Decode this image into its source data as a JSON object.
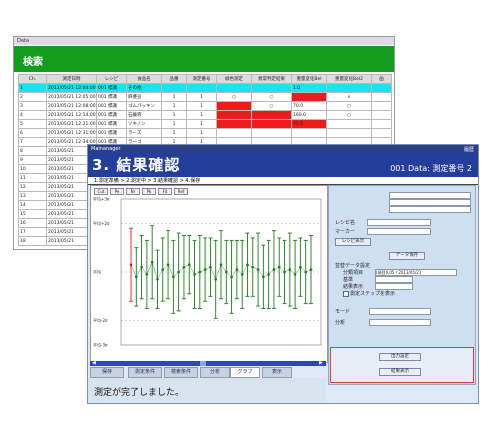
{
  "back_window": {
    "title": "Data",
    "header": "検索",
    "columns": [
      "Ch.",
      "測定日時",
      "レシピ",
      "食品名",
      "品番",
      "測定番号",
      "緑色測定",
      "異常判定結果",
      "重量変化Bel",
      "重量変化Bel2",
      "画"
    ],
    "rows": [
      {
        "no": "1",
        "date": "2013/05/21 12:04:00",
        "recipe": "001 標識",
        "name": "その他",
        "v1": "",
        "v2": "",
        "c1": "",
        "c2": "",
        "val": "1.0",
        "c3": "",
        "highlight": true,
        "red1": false,
        "red2": false,
        "red3": false
      },
      {
        "no": "2",
        "date": "2013/05/21 12:05:00",
        "recipe": "001 標識",
        "name": "麻婆豆",
        "v1": "1",
        "v2": "1",
        "c1": "○",
        "c2": "○",
        "val": "",
        "c3": "×",
        "highlight": false,
        "red1": false,
        "red2": false,
        "red3": true
      },
      {
        "no": "3",
        "date": "2013/05/21 12:08:00",
        "recipe": "001 標識",
        "name": "ゴムパッキン",
        "v1": "1",
        "v2": "1",
        "c1": "",
        "c2": "○",
        "val": "70.0",
        "c3": "○",
        "highlight": false,
        "red1": true,
        "red2": false,
        "red3": false
      },
      {
        "no": "4",
        "date": "2013/05/21 12:14:00",
        "recipe": "001 標識",
        "name": "石鹸液",
        "v1": "1",
        "v2": "1",
        "c1": "",
        "c2": "",
        "val": "160.0",
        "c3": "○",
        "highlight": false,
        "red1": true,
        "red2": true,
        "red3": false
      },
      {
        "no": "5",
        "date": "2013/05/21 12:21:00",
        "recipe": "001 標識",
        "name": "ソキノン",
        "v1": "1",
        "v2": "1",
        "c1": "",
        "c2": "",
        "val": "75.0",
        "c3": "",
        "highlight": false,
        "red1": true,
        "red2": true,
        "red3": true
      },
      {
        "no": "6",
        "date": "2013/05/21 12:31:00",
        "recipe": "001 標識",
        "name": "ラーズ",
        "v1": "1",
        "v2": "1",
        "c1": "",
        "c2": "",
        "val": "",
        "c3": "",
        "highlight": false,
        "red1": false,
        "red2": false,
        "red3": false
      },
      {
        "no": "7",
        "date": "2013/05/21 12:34:00",
        "recipe": "001 標識",
        "name": "ラーゴ",
        "v1": "1",
        "v2": "1",
        "c1": "",
        "c2": "",
        "val": "",
        "c3": "",
        "highlight": false,
        "red1": false,
        "red2": false,
        "red3": false
      },
      {
        "no": "8",
        "date": "2013/05/21",
        "recipe": "",
        "name": "",
        "v1": "",
        "v2": "",
        "c1": "",
        "c2": "",
        "val": "",
        "c3": "",
        "highlight": false,
        "red1": false,
        "red2": false,
        "red3": false
      },
      {
        "no": "9",
        "date": "2013/05/21",
        "recipe": "",
        "name": "",
        "v1": "",
        "v2": "",
        "c1": "",
        "c2": "",
        "val": "",
        "c3": "",
        "highlight": false,
        "red1": false,
        "red2": false,
        "red3": false
      },
      {
        "no": "10",
        "date": "2013/05/21",
        "recipe": "",
        "name": "",
        "v1": "",
        "v2": "",
        "c1": "",
        "c2": "",
        "val": "",
        "c3": "",
        "highlight": false,
        "red1": false,
        "red2": false,
        "red3": false
      },
      {
        "no": "11",
        "date": "2013/05/21",
        "recipe": "",
        "name": "",
        "v1": "",
        "v2": "",
        "c1": "",
        "c2": "",
        "val": "",
        "c3": "",
        "highlight": false,
        "red1": false,
        "red2": false,
        "red3": false
      },
      {
        "no": "12",
        "date": "2013/05/21",
        "recipe": "",
        "name": "",
        "v1": "",
        "v2": "",
        "c1": "",
        "c2": "",
        "val": "",
        "c3": "",
        "highlight": false,
        "red1": false,
        "red2": false,
        "red3": false
      },
      {
        "no": "13",
        "date": "2013/05/21",
        "recipe": "",
        "name": "",
        "v1": "",
        "v2": "",
        "c1": "",
        "c2": "",
        "val": "",
        "c3": "",
        "highlight": false,
        "red1": false,
        "red2": false,
        "red3": false
      },
      {
        "no": "14",
        "date": "2013/05/21",
        "recipe": "",
        "name": "",
        "v1": "",
        "v2": "",
        "c1": "",
        "c2": "",
        "val": "",
        "c3": "",
        "highlight": false,
        "red1": false,
        "red2": false,
        "red3": false
      },
      {
        "no": "15",
        "date": "2013/05/21",
        "recipe": "",
        "name": "",
        "v1": "",
        "v2": "",
        "c1": "",
        "c2": "",
        "val": "",
        "c3": "",
        "highlight": false,
        "red1": false,
        "red2": false,
        "red3": false
      },
      {
        "no": "16",
        "date": "2013/05/21",
        "recipe": "",
        "name": "",
        "v1": "",
        "v2": "",
        "c1": "",
        "c2": "",
        "val": "",
        "c3": "",
        "highlight": false,
        "red1": false,
        "red2": false,
        "red3": false
      },
      {
        "no": "17",
        "date": "2013/05/21",
        "recipe": "",
        "name": "",
        "v1": "",
        "v2": "",
        "c1": "",
        "c2": "",
        "val": "",
        "c3": "",
        "highlight": false,
        "red1": false,
        "red2": false,
        "red3": false
      },
      {
        "no": "18",
        "date": "2013/05/21",
        "recipe": "",
        "name": "",
        "v1": "",
        "v2": "",
        "c1": "",
        "c2": "",
        "val": "",
        "c3": "",
        "highlight": false,
        "red1": false,
        "red2": false,
        "red3": false
      }
    ]
  },
  "front_window": {
    "app_title": "Mainanager",
    "title_right": "履歴",
    "step_title": "3. 結果確認",
    "subtitle": "001 Data: 測定番号 2",
    "progress_text": "1.測定準備 > 2.測定中 > 3.結果確認 > 4.保存",
    "toolbar": [
      "Cut",
      "Pe",
      "Nr",
      "Pk",
      "Fit",
      "Ref"
    ],
    "y_labels": [
      "平均+3σ",
      "平均+2σ",
      "平均",
      "平均-2σ",
      "平均-3σ"
    ],
    "right_panel": {
      "recipe_label": "レシピ名",
      "marker_label": "マーカー",
      "recipe_btn": "レシピ表示",
      "data_btn": "データ保存",
      "sort_label": "並替データ設定",
      "sort_label2": "分類項目",
      "sort_label3": "基準",
      "sort_value": "(項目)L05 / 2013/05/21",
      "filter_label": "結果表示",
      "check_label": "測定ステップを表示",
      "mode_label": "モード",
      "unit_label": "分析",
      "settings_btn": "出力設定",
      "end_btn": "結果表示"
    },
    "tabs": [
      "保存",
      "測定条件",
      "検索条件",
      "分析",
      "グラフ",
      "表示"
    ],
    "status": "測定が完了しました。"
  },
  "chart_data": {
    "type": "scatter",
    "title": "",
    "xlabel": "",
    "ylabel": "",
    "ylim": [
      -3,
      3
    ],
    "grid": true,
    "series": [
      {
        "color": "#1b7a1b",
        "x": [
          1,
          2,
          3,
          4,
          5,
          6,
          7,
          8,
          9,
          10,
          11,
          12,
          13,
          14,
          15,
          16,
          17,
          18,
          19,
          20,
          21,
          22,
          23,
          24,
          25,
          26,
          27,
          28,
          29,
          30,
          31,
          32,
          33,
          34,
          35
        ],
        "y": [
          0.3,
          -0.2,
          0.2,
          -0.1,
          0.4,
          -0.3,
          0.1,
          0.3,
          -0.2,
          0.0,
          0.2,
          0.3,
          -0.1,
          0.0,
          0.1,
          0.2,
          -0.3,
          0.3,
          0.0,
          -0.2,
          0.1,
          -0.1,
          0.3,
          0.2,
          0.1,
          -0.2,
          -0.1,
          0.1,
          0.2,
          0.0,
          0.1,
          -0.1,
          0.2,
          0.0,
          0.1
        ],
        "err": [
          1.5,
          1.2,
          1.3,
          1.4,
          1.5,
          1.2,
          1.3,
          1.4,
          1.5,
          1.6,
          1.3,
          1.2,
          1.4,
          1.5,
          1.3,
          1.2,
          1.6,
          1.4,
          1.3,
          1.5,
          1.2,
          1.4,
          1.3,
          1.2,
          1.5,
          1.3,
          1.4,
          1.6,
          1.2,
          1.3,
          1.5,
          1.4,
          1.2,
          1.3,
          1.4
        ]
      }
    ],
    "highlight": {
      "x": 1,
      "color": "#ee1b1b"
    }
  }
}
